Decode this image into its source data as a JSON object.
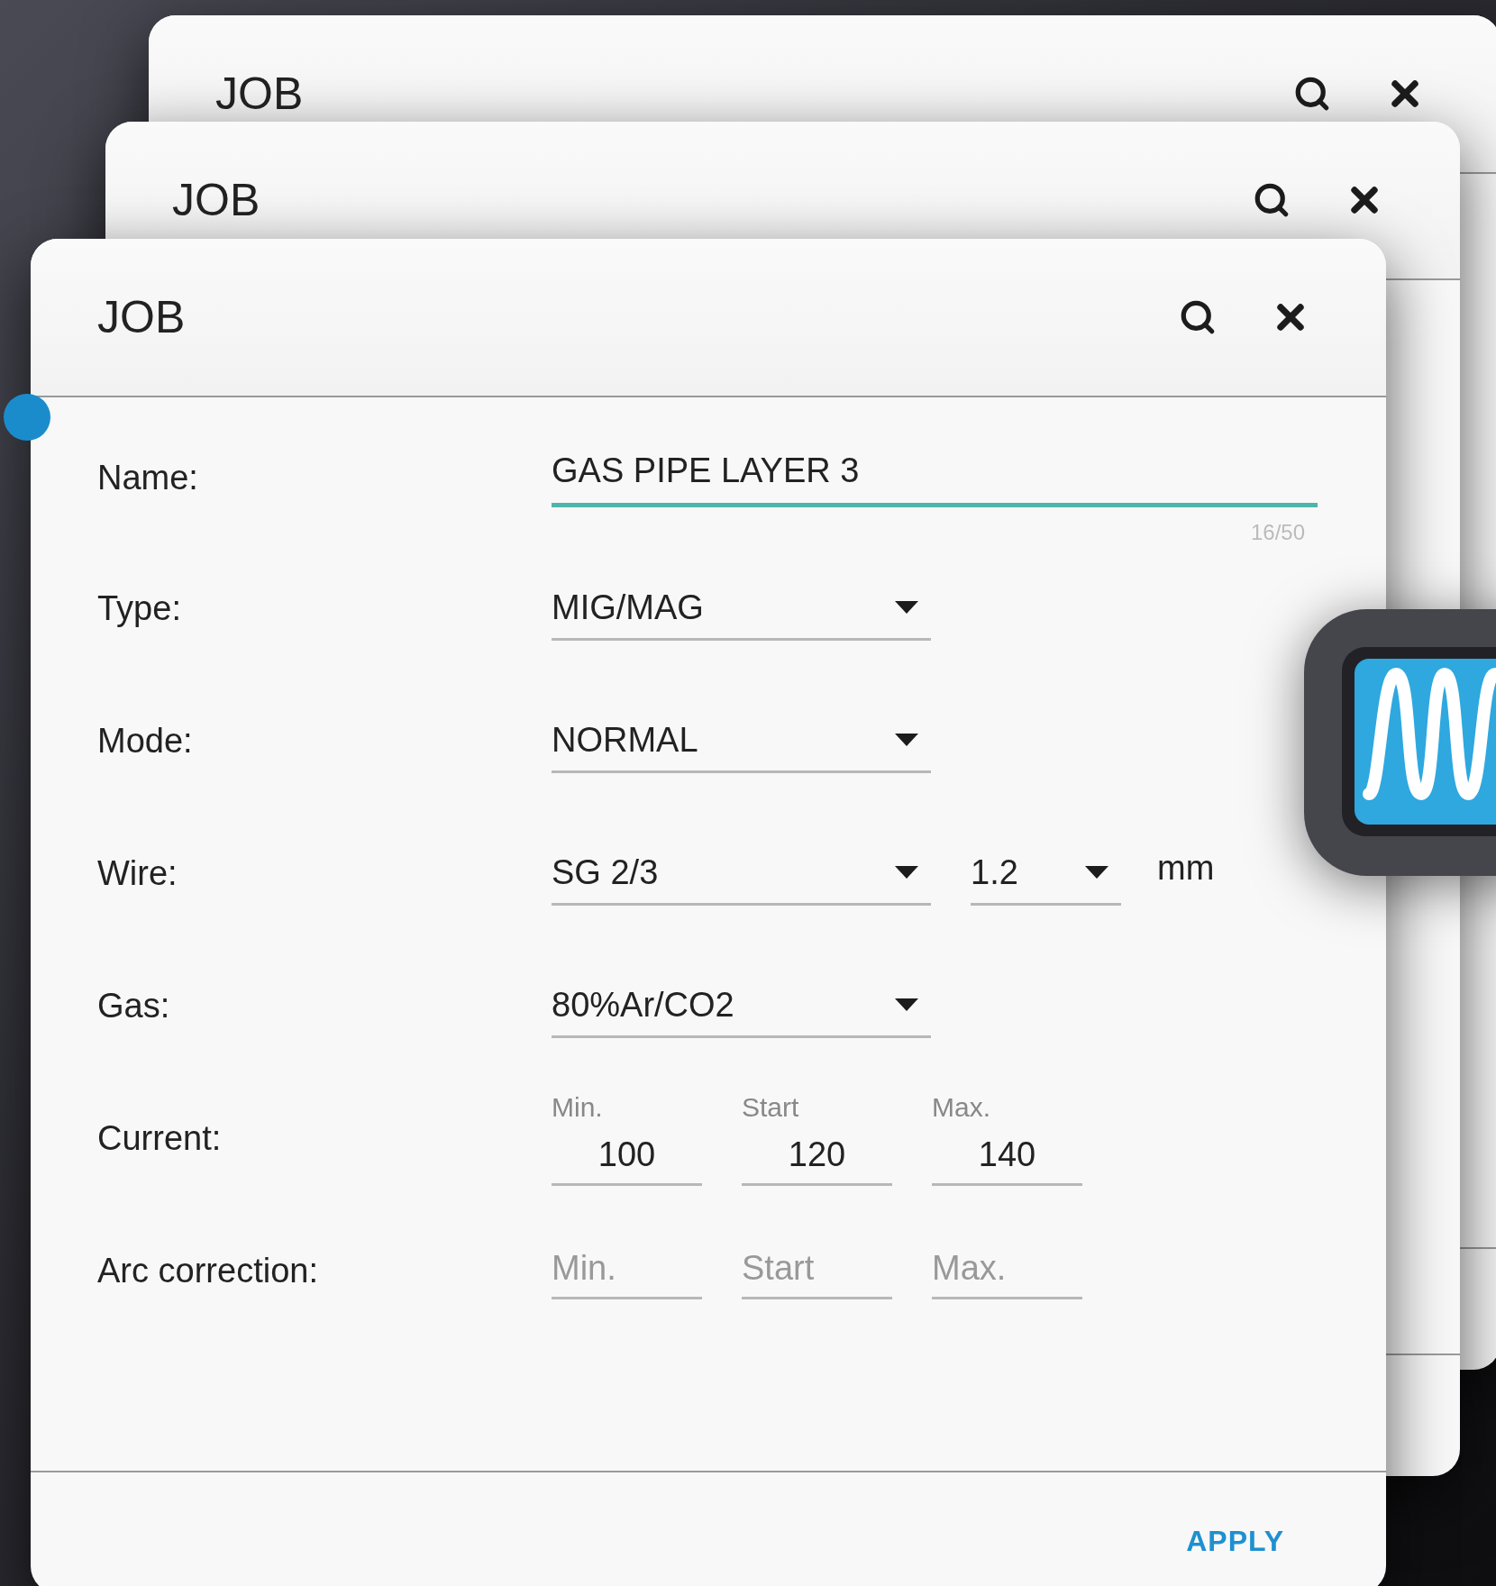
{
  "background_windows": [
    {
      "title": "JOB"
    },
    {
      "title": "JOB"
    }
  ],
  "dialog": {
    "title": "JOB",
    "fields": [
      {
        "kind": "text",
        "label": "Name:",
        "value": "GAS PIPE LAYER 3",
        "counter": "16/50",
        "focused": true
      },
      {
        "kind": "select",
        "label": "Type:",
        "value": "MIG/MAG"
      },
      {
        "kind": "select",
        "label": "Mode:",
        "value": "NORMAL"
      },
      {
        "kind": "select_pair",
        "label": "Wire:",
        "value": "SG 2/3",
        "second_value": "1.2",
        "unit": "mm"
      },
      {
        "kind": "select",
        "label": "Gas:",
        "value": "80%Ar/CO2"
      },
      {
        "kind": "range",
        "label": "Current:",
        "inputs": [
          {
            "caption": "Min.",
            "value": "100"
          },
          {
            "caption": "Start",
            "value": "120"
          },
          {
            "caption": "Max.",
            "value": "140"
          }
        ]
      },
      {
        "kind": "range",
        "label": "Arc correction:",
        "inputs": [
          {
            "placeholder": "Min."
          },
          {
            "placeholder": "Start"
          },
          {
            "placeholder": "Max."
          }
        ]
      }
    ],
    "button": "APPLY"
  }
}
